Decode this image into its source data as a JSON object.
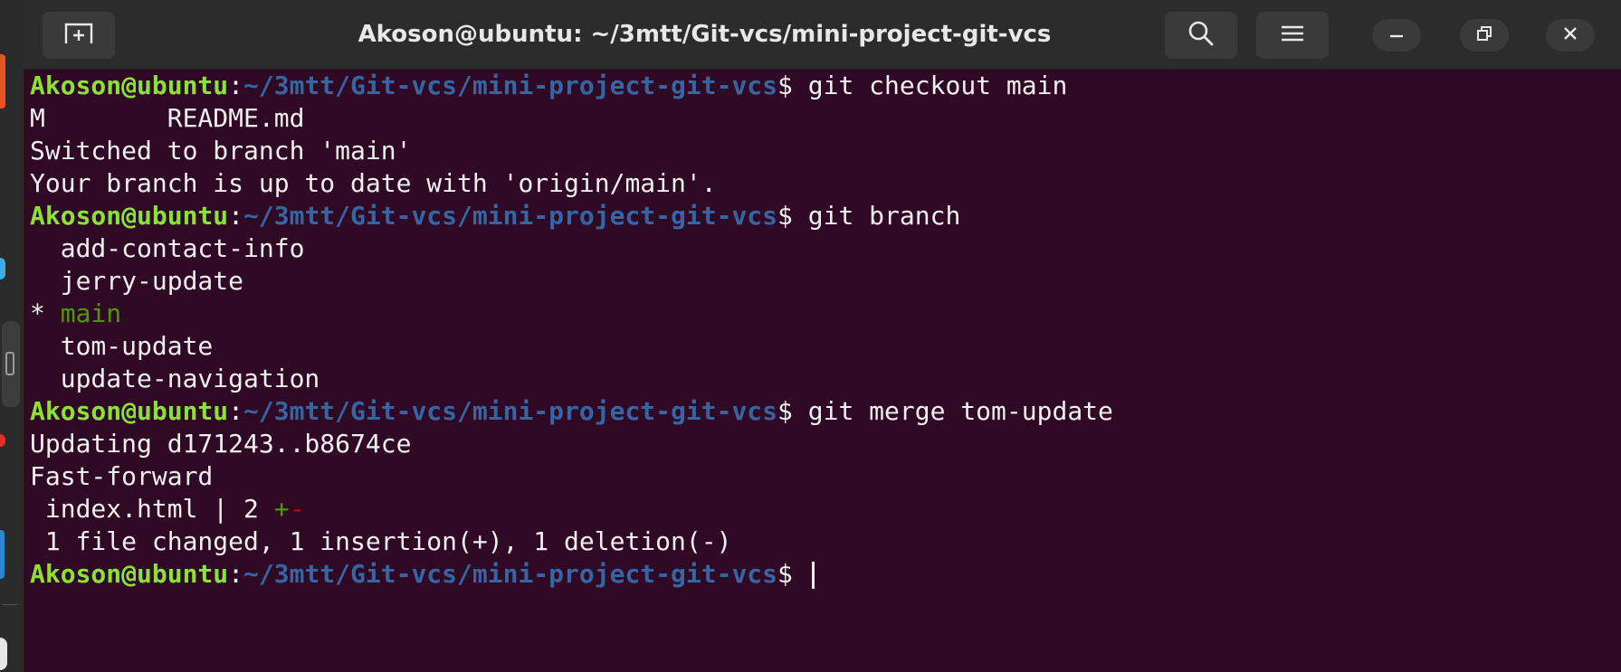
{
  "window": {
    "title": "Akoson@ubuntu: ~/3mtt/Git-vcs/mini-project-git-vcs"
  },
  "titlebar": {
    "new_tab_icon": "new-tab-icon",
    "search_icon": "search-icon",
    "menu_icon": "hamburger-menu-icon",
    "minimize_icon": "minimize-icon",
    "maximize_icon": "restore-icon",
    "close_icon": "close-icon"
  },
  "prompt": {
    "user": "Akoson@ubuntu",
    "colon": ":",
    "path": "~/3mtt/Git-vcs/mini-project-git-vcs",
    "dollar": "$"
  },
  "terminal": {
    "cmd1": " git checkout main",
    "out1": [
      "M\tREADME.md",
      "Switched to branch 'main'",
      "Your branch is up to date with 'origin/main'."
    ],
    "cmd2": " git branch",
    "branches": {
      "b1": "  add-contact-info",
      "b2": "  jerry-update",
      "current_marker": "* ",
      "current": "main",
      "b4": "  tom-update",
      "b5": "  update-navigation"
    },
    "cmd3": " git merge tom-update",
    "merge": {
      "updating": "Updating d171243..b8674ce",
      "fastforward": "Fast-forward",
      "file_stat": " index.html | 2 ",
      "plus": "+",
      "minus": "-",
      "summary": " 1 file changed, 1 insertion(+), 1 deletion(-)"
    },
    "cmd4": " "
  },
  "colors": {
    "background": "#300a24",
    "user": "#8ae234",
    "path": "#3465a4",
    "current_branch": "#4e9a06",
    "deletion": "#cc0000"
  }
}
